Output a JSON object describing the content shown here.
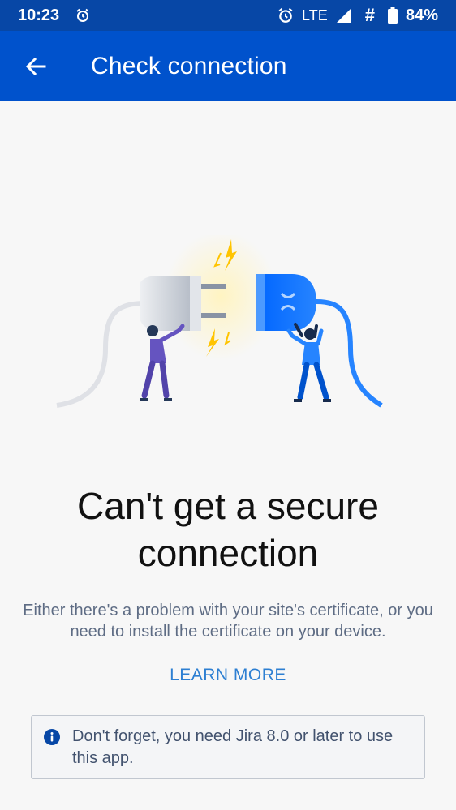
{
  "status_bar": {
    "time": "10:23",
    "network": "LTE",
    "hash": "#",
    "battery": "84%"
  },
  "app_bar": {
    "title": "Check connection",
    "back_icon": "arrow-left-icon"
  },
  "main": {
    "heading": "Can't get a secure connection",
    "description": "Either there's a problem with your site's certificate, or you need to install the certificate on your device.",
    "learn_more": "LEARN MORE",
    "notice": "Don't forget, you need Jira 8.0 or later to use this app."
  },
  "colors": {
    "status_bar": "#0747a6",
    "app_bar": "#0052cc",
    "link": "#2d7fd2",
    "background": "#f7f7f7"
  }
}
